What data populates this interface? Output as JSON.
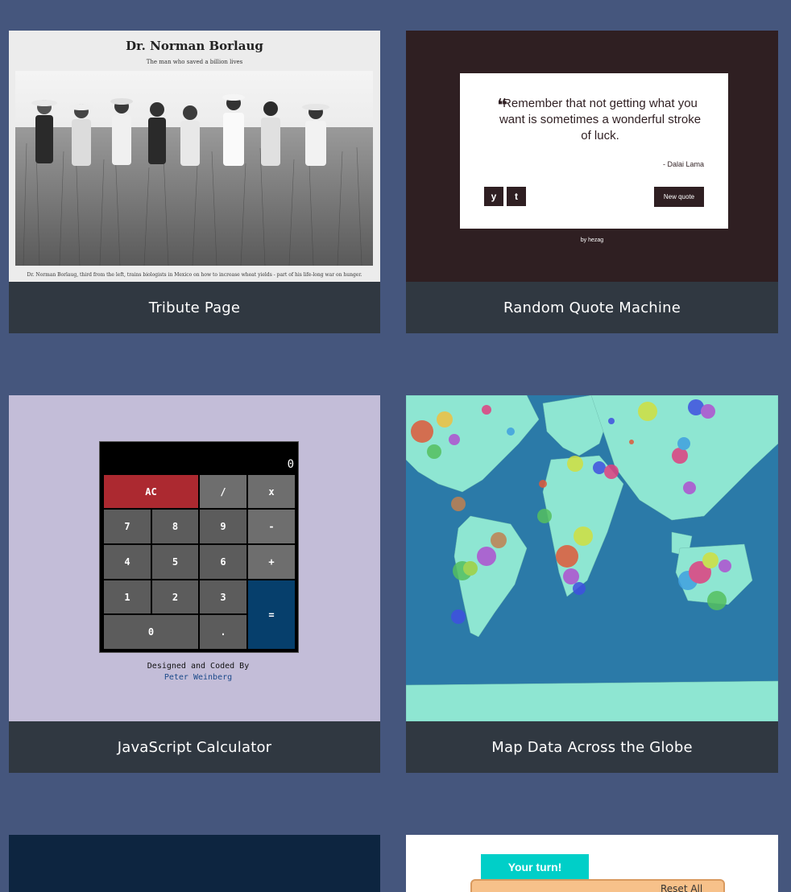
{
  "colors": {
    "page_bg": "#45567d",
    "caption_bg": "#303841",
    "caption_text": "#ffffff"
  },
  "projects": [
    {
      "title": "Tribute Page",
      "thumb": {
        "heading": "Dr. Norman Borlaug",
        "subheading": "The man who saved a billion lives",
        "caption": "Dr. Norman Borlaug, third from the left, trains biologists in Mexico on how to increase wheat yields - part of his life-long war on hunger."
      }
    },
    {
      "title": "Random Quote Machine",
      "thumb": {
        "quote": "Remember that not getting what you want is sometimes a wonderful stroke of luck.",
        "author": "- Dalai Lama",
        "twitter_icon": "twitter-icon",
        "tumblr_icon": "tumblr-icon",
        "twitter_glyph": "y",
        "tumblr_glyph": "t",
        "new_quote_label": "New quote",
        "byline": "by hezag"
      }
    },
    {
      "title": "JavaScript Calculator",
      "thumb": {
        "display": "0",
        "keys": [
          "AC",
          "/",
          "x",
          "7",
          "8",
          "9",
          "-",
          "4",
          "5",
          "6",
          "+",
          "1",
          "2",
          "3",
          "=",
          "0",
          "."
        ],
        "credit": "Designed and Coded By",
        "author": "Peter Weinberg"
      }
    },
    {
      "title": "Map Data Across the Globe"
    },
    {
      "title": ""
    },
    {
      "title": "",
      "thumb": {
        "turn_label": "Your turn!",
        "reset_label": "Reset All"
      }
    }
  ]
}
